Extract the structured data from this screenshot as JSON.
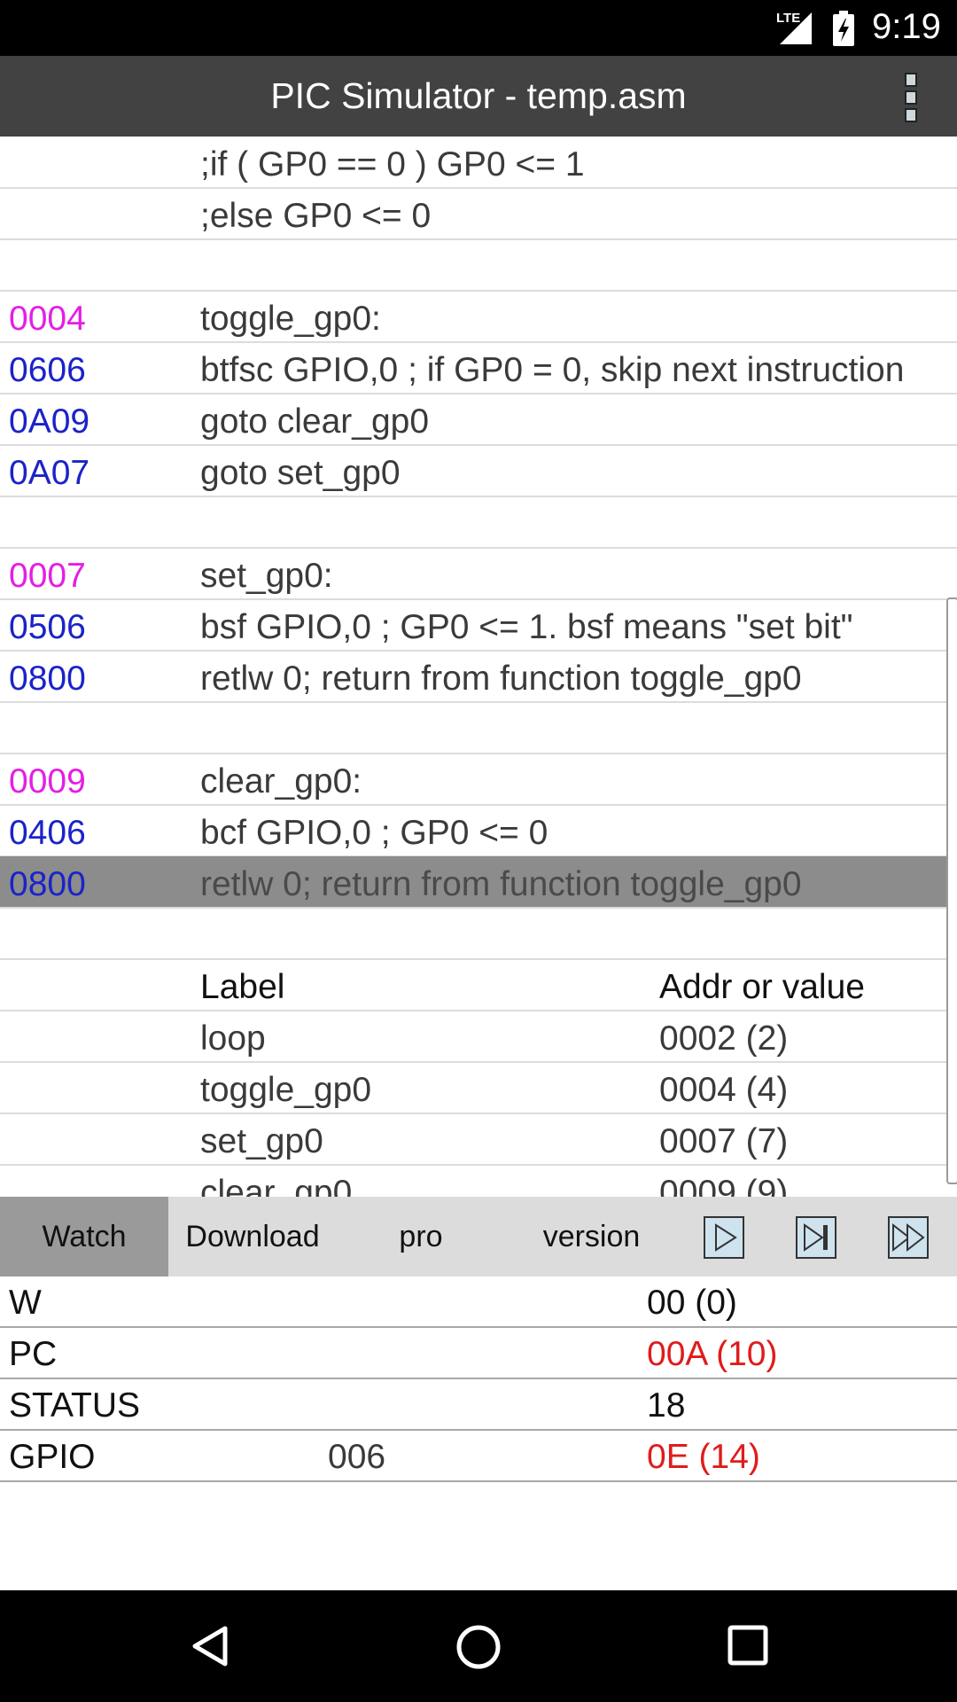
{
  "status_bar": {
    "network": "LTE",
    "time": "9:19"
  },
  "app_bar": {
    "title": "PIC Simulator - temp.asm",
    "menu_icon": "overflow-menu-icon"
  },
  "code_rows": [
    {
      "addr": "",
      "code": ";if ( GP0 == 0 ) GP0 <= 1",
      "kind": "comment"
    },
    {
      "addr": "",
      "code": ";else GP0 <= 0",
      "kind": "comment"
    },
    {
      "addr": "",
      "code": "",
      "kind": "blank"
    },
    {
      "addr": "0004",
      "code": "toggle_gp0:",
      "kind": "label"
    },
    {
      "addr": "0606",
      "code": "btfsc GPIO,0 ; if GP0 = 0, skip next instruction",
      "kind": "instr"
    },
    {
      "addr": "0A09",
      "code": "goto clear_gp0",
      "kind": "instr"
    },
    {
      "addr": "0A07",
      "code": "goto set_gp0",
      "kind": "instr"
    },
    {
      "addr": "",
      "code": "",
      "kind": "blank"
    },
    {
      "addr": "0007",
      "code": "set_gp0:",
      "kind": "label"
    },
    {
      "addr": "0506",
      "code": "bsf GPIO,0 ; GP0 <= 1. bsf means \"set bit\"",
      "kind": "instr"
    },
    {
      "addr": "0800",
      "code": "retlw 0; return from function toggle_gp0",
      "kind": "instr"
    },
    {
      "addr": "",
      "code": "",
      "kind": "blank"
    },
    {
      "addr": "0009",
      "code": "clear_gp0:",
      "kind": "label"
    },
    {
      "addr": "0406",
      "code": "bcf GPIO,0 ; GP0 <= 0",
      "kind": "instr"
    },
    {
      "addr": "0800",
      "code": "retlw 0; return from function toggle_gp0",
      "kind": "instr",
      "highlighted": true
    },
    {
      "addr": "",
      "code": "",
      "kind": "blank"
    }
  ],
  "symbol_table": {
    "headers": {
      "label": "Label",
      "value": "Addr or value"
    },
    "rows": [
      {
        "label": "loop",
        "value": "0002 (2)"
      },
      {
        "label": "toggle_gp0",
        "value": "0004 (4)"
      },
      {
        "label": "set_gp0",
        "value": "0007 (7)"
      },
      {
        "label": "clear_gp0",
        "value": "0009 (9)"
      }
    ]
  },
  "toolbar": {
    "tabs": [
      {
        "label": "Watch",
        "active": true
      },
      {
        "label": "Download",
        "active": false
      },
      {
        "label": "pro",
        "active": false
      },
      {
        "label": "version",
        "active": false
      }
    ],
    "run_icon": "play-icon",
    "step_icon": "step-icon",
    "fast_forward_icon": "fast-forward-icon"
  },
  "watch": [
    {
      "name": "W",
      "mid": "",
      "value": "00 (0)",
      "changed": false
    },
    {
      "name": "PC",
      "mid": "",
      "value": "00A (10)",
      "changed": true
    },
    {
      "name": "STATUS",
      "mid": "",
      "value": "18",
      "changed": false
    },
    {
      "name": "GPIO",
      "mid": "006",
      "value": "0E (14)",
      "changed": true
    }
  ],
  "colors": {
    "label_addr": "#e51ee5",
    "instr_addr": "#1a23c8",
    "changed_value": "#e01b1b",
    "highlight_row": "#8c8c8c",
    "app_bar": "#424242"
  }
}
